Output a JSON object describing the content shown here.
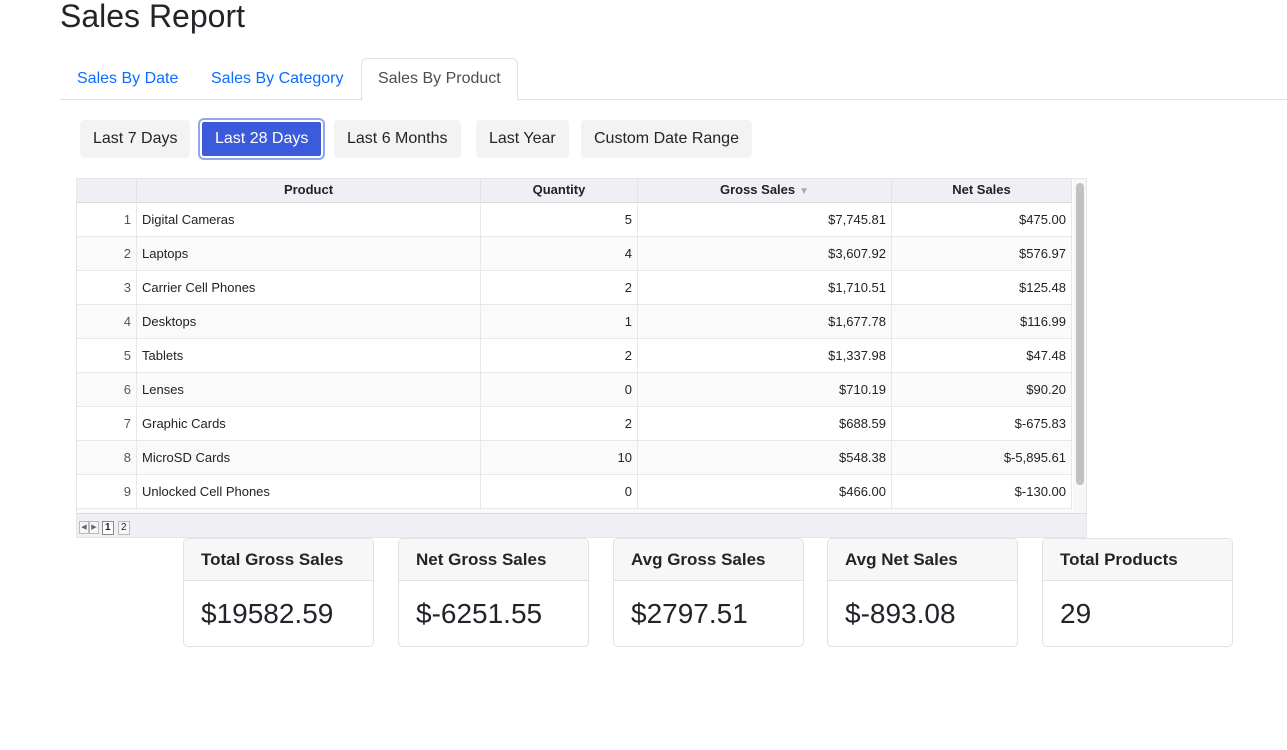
{
  "page": {
    "title": "Sales Report"
  },
  "tabs": [
    {
      "label": "Sales By Date",
      "active": false
    },
    {
      "label": "Sales By Category",
      "active": false
    },
    {
      "label": "Sales By Product",
      "active": true
    }
  ],
  "ranges": [
    {
      "label": "Last 7 Days",
      "active": false
    },
    {
      "label": "Last 28 Days",
      "active": true
    },
    {
      "label": "Last 6 Months",
      "active": false
    },
    {
      "label": "Last Year",
      "active": false
    },
    {
      "label": "Custom Date Range",
      "active": false
    }
  ],
  "table": {
    "columns": [
      "Product",
      "Quantity",
      "Gross Sales",
      "Net Sales"
    ],
    "sorted_column": "Gross Sales",
    "sort_direction": "descending",
    "rows": [
      {
        "idx": "1",
        "product": "Digital Cameras",
        "quantity": "5",
        "gross": "$7,745.81",
        "net": "$475.00"
      },
      {
        "idx": "2",
        "product": "Laptops",
        "quantity": "4",
        "gross": "$3,607.92",
        "net": "$576.97"
      },
      {
        "idx": "3",
        "product": "Carrier Cell Phones",
        "quantity": "2",
        "gross": "$1,710.51",
        "net": "$125.48"
      },
      {
        "idx": "4",
        "product": "Desktops",
        "quantity": "1",
        "gross": "$1,677.78",
        "net": "$116.99"
      },
      {
        "idx": "5",
        "product": "Tablets",
        "quantity": "2",
        "gross": "$1,337.98",
        "net": "$47.48"
      },
      {
        "idx": "6",
        "product": "Lenses",
        "quantity": "0",
        "gross": "$710.19",
        "net": "$90.20"
      },
      {
        "idx": "7",
        "product": "Graphic Cards",
        "quantity": "2",
        "gross": "$688.59",
        "net": "$-675.83"
      },
      {
        "idx": "8",
        "product": "MicroSD Cards",
        "quantity": "10",
        "gross": "$548.38",
        "net": "$-5,895.61"
      },
      {
        "idx": "9",
        "product": "Unlocked Cell Phones",
        "quantity": "0",
        "gross": "$466.00",
        "net": "$-130.00"
      }
    ]
  },
  "pager": {
    "prev_icon": "triangle-left-icon",
    "next_icon": "triangle-right-icon",
    "pages": [
      "1",
      "2"
    ],
    "current_page": "1"
  },
  "cards": [
    {
      "title": "Total Gross Sales",
      "value": "$19582.59"
    },
    {
      "title": "Net Gross Sales",
      "value": "$-6251.55"
    },
    {
      "title": "Avg Gross Sales",
      "value": "$2797.51"
    },
    {
      "title": "Avg Net Sales",
      "value": "$-893.08"
    },
    {
      "title": "Total Products",
      "value": "29"
    }
  ],
  "colors": {
    "link": "#0d6efd",
    "active_button": "#3b5bdb",
    "button_bg": "#f3f3f3",
    "grid_header_bg": "#eef0f6"
  }
}
